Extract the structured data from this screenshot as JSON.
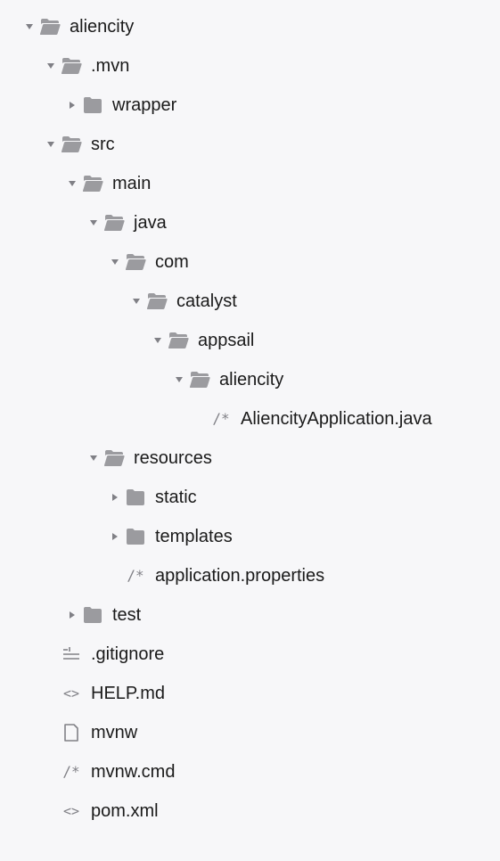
{
  "tree": {
    "aliencity": "aliencity",
    "mvn": ".mvn",
    "wrapper": "wrapper",
    "src": "src",
    "main": "main",
    "java": "java",
    "com": "com",
    "catalyst": "catalyst",
    "appsail": "appsail",
    "aliencity_pkg": "aliencity",
    "aliencity_app": "AliencityApplication.java",
    "resources": "resources",
    "static": "static",
    "templates": "templates",
    "app_props": "application.properties",
    "test": "test",
    "gitignore": ".gitignore",
    "help": "HELP.md",
    "mvnw": "mvnw",
    "mvnw_cmd": "mvnw.cmd",
    "pom": "pom.xml"
  }
}
